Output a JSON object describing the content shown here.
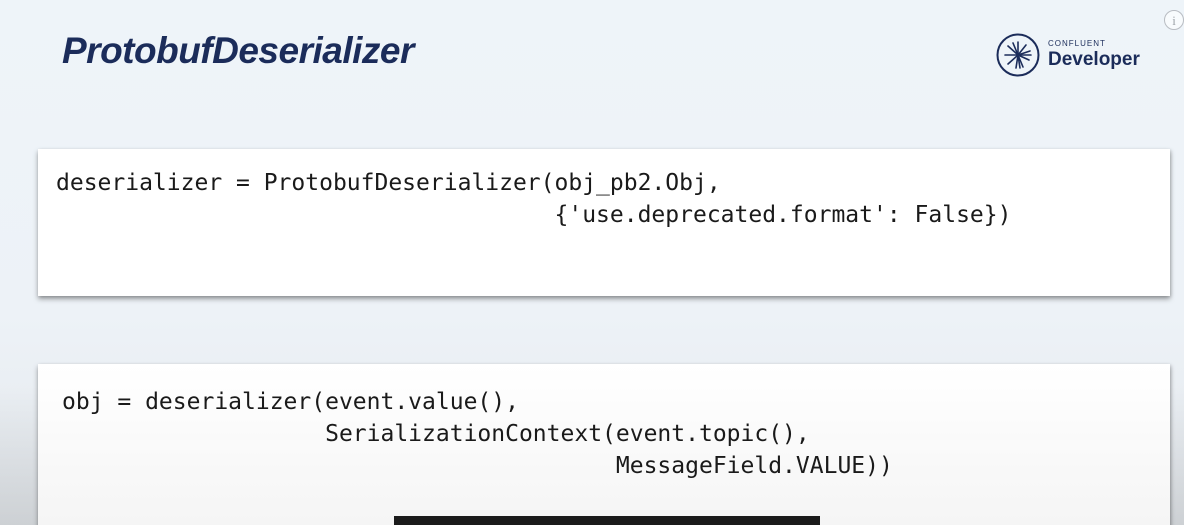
{
  "slide": {
    "title": "ProtobufDeserializer",
    "logo": {
      "small_text": "CONFLUENT",
      "big_text": "Developer",
      "icon": "confluent-starburst-icon"
    },
    "info_icon": {
      "glyph": "i",
      "icon": "info-icon"
    },
    "code_blocks": [
      {
        "lines": [
          "deserializer = ProtobufDeserializer(obj_pb2.Obj,",
          "                                    {'use.deprecated.format': False})"
        ]
      },
      {
        "lines": [
          "obj = deserializer(event.value(),",
          "                   SerializationContext(event.topic(),",
          "                                        MessageField.VALUE))"
        ]
      }
    ]
  },
  "colors": {
    "title": "#1b2c5a",
    "background": "#eef3f8",
    "code_text": "#1a1a1a",
    "caption_bg": "#080808"
  }
}
